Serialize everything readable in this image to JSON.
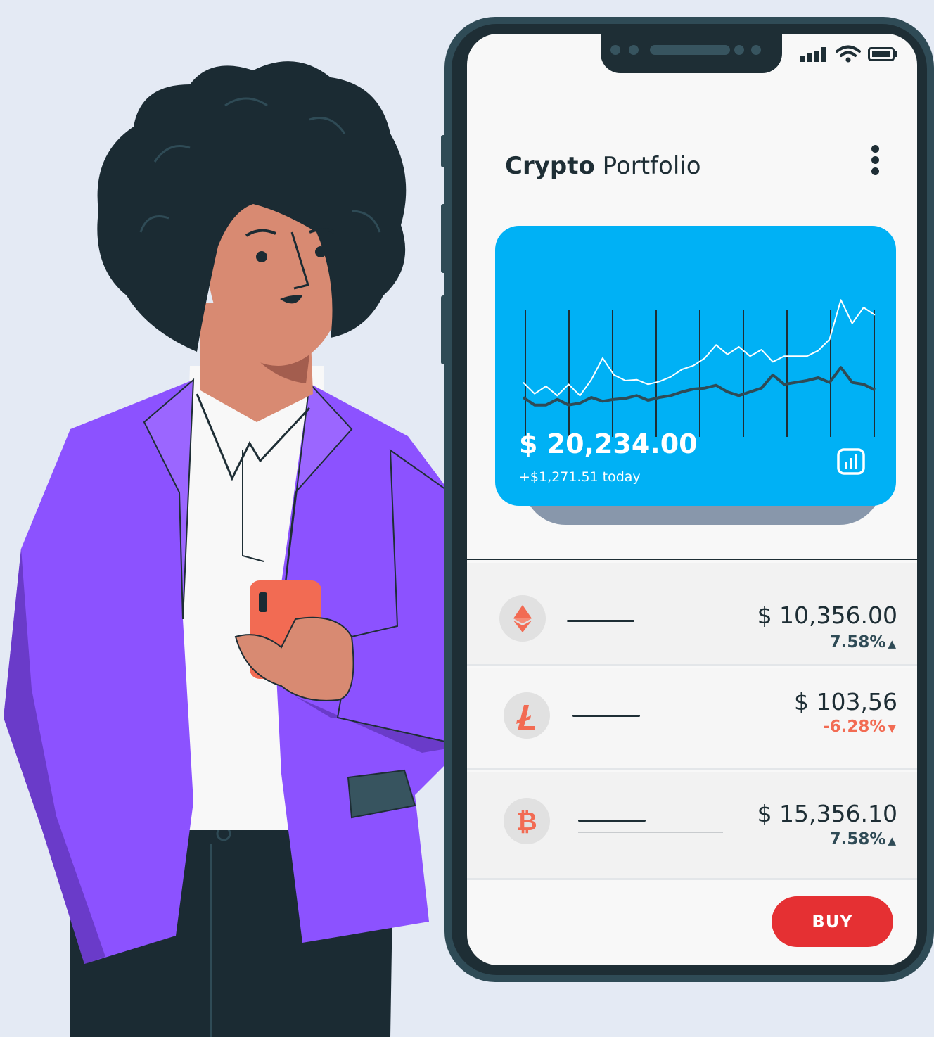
{
  "app": {
    "title_bold": "Crypto",
    "title_rest": "Portfolio"
  },
  "portfolio": {
    "total": "$ 20,234.00",
    "change_today": "+$1,271.51 today"
  },
  "chart_data": {
    "type": "line",
    "series": [
      {
        "values": [
          52,
          40,
          48,
          38,
          50,
          38,
          55,
          78,
          60,
          54,
          55,
          50,
          53,
          58,
          66,
          70,
          78,
          92,
          82,
          90,
          80,
          87,
          74,
          80,
          80,
          80,
          86,
          98,
          140,
          115,
          132,
          124
        ]
      },
      {
        "values": [
          36,
          28,
          28,
          34,
          28,
          30,
          36,
          32,
          34,
          35,
          38,
          33,
          36,
          38,
          42,
          45,
          46,
          49,
          42,
          38,
          42,
          46,
          60,
          50,
          52,
          54,
          57,
          52,
          68,
          52,
          50,
          44
        ]
      }
    ],
    "colors": [
      "#ffffff",
      "#2f4b56"
    ]
  },
  "coins": [
    {
      "icon": "ethereum-icon",
      "price": "$ 10,356.00",
      "change": "7.58%",
      "direction": "up"
    },
    {
      "icon": "litecoin-icon",
      "price": "$ 103,56",
      "change": "-6.28%",
      "direction": "down"
    },
    {
      "icon": "bitcoin-icon",
      "price": "$ 15,356.10",
      "change": "7.58%",
      "direction": "up"
    }
  ],
  "actions": {
    "buy_label": "BUY"
  },
  "colors": {
    "accent": "#00b1f5",
    "buy": "#e53033",
    "positive": "#2f4b56",
    "negative": "#f26b53",
    "jacket": "#8c52ff"
  }
}
